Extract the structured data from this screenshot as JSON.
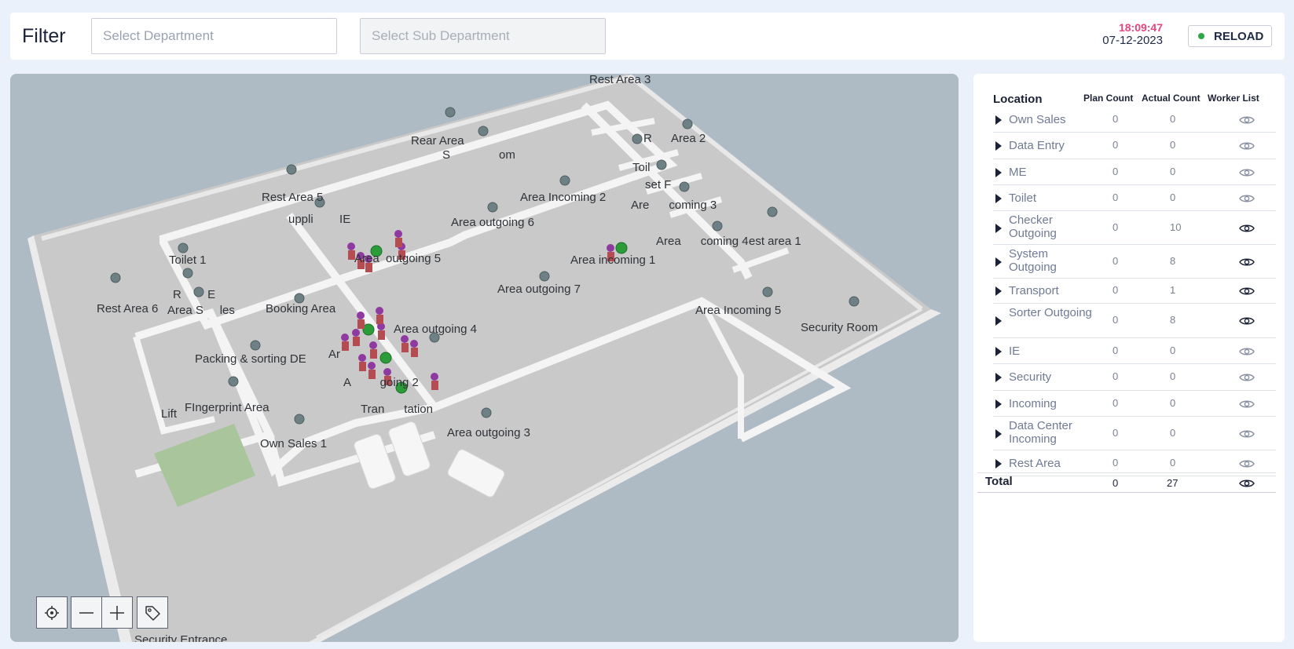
{
  "header": {
    "title": "Filter",
    "department_placeholder": "Select Department",
    "sub_department_placeholder": "Select Sub Department",
    "time": "18:09:47",
    "date": "07-12-2023",
    "reload_label": "RELOAD",
    "reload_status_color": "#2ca84a"
  },
  "map": {
    "labels": {
      "rest_area_3": "Rest Area 3",
      "rear_area": "Rear Area",
      "s_room": "S",
      "om": "om",
      "rest_area_2": "R      Area 2",
      "area_incoming_2": "Area Incoming 2",
      "toilet_a": "Toil",
      "set": "set F",
      "area_incoming_3": "Are      coming 3",
      "rest_area_5": "Rest Area 5",
      "supplier_ie": "uppli        IE",
      "area_outgoing_6": "Area outgoing 6",
      "area_incoming_4": "Area      coming 4",
      "rest_area_1": "est area 1",
      "toilet_1": "Toilet 1",
      "area_outgoing_5": "Area  outgoing 5",
      "area_incoming_1": "Area incoming 1",
      "rest_area_6": "Rest Area 6",
      "r_e": "R        E",
      "area_samples": "Area S     les",
      "booking_area": "Booking Area",
      "area_outgoing_7": "Area outgoing 7",
      "area_incoming_5": "Area Incoming 5",
      "security_room": "Security Room",
      "area_outgoing_4": "Area outgoing 4",
      "packing": "Packing & sorting DE",
      "ar": "Ar",
      "area_outgoing_2": "A         going 2",
      "lift": "Lift",
      "fingerprint": "FIngerprint Area",
      "transportation": "Tran      tation",
      "own_sales_1": "Own Sales 1",
      "area_outgoing_3": "Area outgoing 3",
      "security_entrance": "Security Entrance"
    },
    "controls": {
      "locate_icon": "crosshair-icon",
      "zoom_out_icon": "minus-icon",
      "zoom_in_icon": "plus-icon",
      "tag_icon": "tag-icon"
    }
  },
  "table": {
    "headers": {
      "location": "Location",
      "plan": "Plan Count",
      "actual": "Actual Count",
      "workers": "Worker List"
    },
    "rows": [
      {
        "name": "Own Sales",
        "plan": "0",
        "actual": "0"
      },
      {
        "name": "Data Entry",
        "plan": "0",
        "actual": "0"
      },
      {
        "name": "ME",
        "plan": "0",
        "actual": "0"
      },
      {
        "name": "Toilet",
        "plan": "0",
        "actual": "0"
      },
      {
        "name": "Checker Outgoing",
        "plan": "0",
        "actual": "10"
      },
      {
        "name": "System Outgoing",
        "plan": "0",
        "actual": "8"
      },
      {
        "name": "Transport",
        "plan": "0",
        "actual": "1"
      },
      {
        "name": "Sorter Outgoing",
        "plan": "0",
        "actual": "8"
      },
      {
        "name": "IE",
        "plan": "0",
        "actual": "0"
      },
      {
        "name": "Security",
        "plan": "0",
        "actual": "0"
      },
      {
        "name": "Incoming",
        "plan": "0",
        "actual": "0"
      },
      {
        "name": "Data Center Incoming",
        "plan": "0",
        "actual": "0"
      },
      {
        "name": "Rest Area",
        "plan": "0",
        "actual": "0"
      }
    ],
    "total": {
      "label": "Total",
      "plan": "0",
      "actual": "27"
    },
    "eye_icon": "eye-icon"
  }
}
